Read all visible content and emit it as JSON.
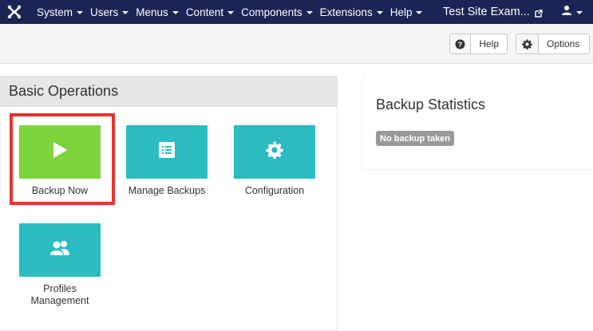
{
  "navbar": {
    "logo": "joomla-logo",
    "menu": [
      {
        "label": "System"
      },
      {
        "label": "Users"
      },
      {
        "label": "Menus"
      },
      {
        "label": "Content"
      },
      {
        "label": "Components"
      },
      {
        "label": "Extensions"
      },
      {
        "label": "Help"
      }
    ],
    "site_link": "Test Site Exam...",
    "site_icon": "external-link-icon",
    "user_icon": "user-icon"
  },
  "toolbar": {
    "help_label": "Help",
    "help_icon": "question-circle-icon",
    "options_label": "Options",
    "options_icon": "gear-icon"
  },
  "basic_operations": {
    "title": "Basic Operations",
    "items": [
      {
        "label": "Backup Now",
        "icon": "play-icon",
        "color": "#7ed43c",
        "highlighted": true
      },
      {
        "label": "Manage Backups",
        "icon": "list-icon",
        "color": "#2bbbc0"
      },
      {
        "label": "Configuration",
        "icon": "gear-icon",
        "color": "#2bbbc0"
      },
      {
        "label": "Profiles Management",
        "icon": "users-icon",
        "color": "#2bbbc0"
      }
    ]
  },
  "backup_statistics": {
    "title": "Backup Statistics",
    "badge": "No backup taken"
  },
  "colors": {
    "navbar": "#1b2555",
    "green_tile": "#7ed43c",
    "teal_tile": "#2bbbc0",
    "highlight": "#e8332f",
    "badge": "#999999"
  }
}
